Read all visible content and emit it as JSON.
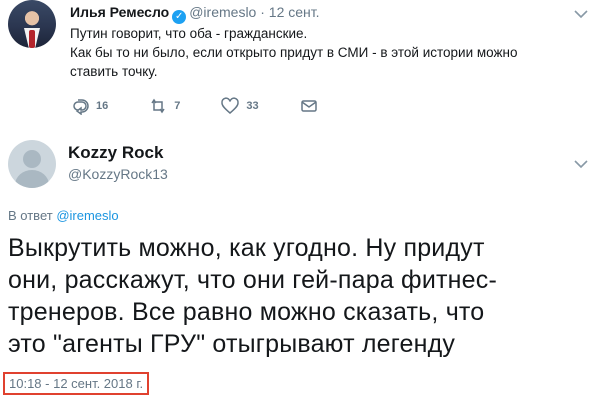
{
  "tweet1": {
    "name": "Илья Ремесло",
    "handle": "@iremeslo",
    "date": "· 12 сент.",
    "text_lines": [
      "Путин говорит, что оба - гражданские.",
      "Как бы то ни было, если открыто придут в СМИ - в этой истории можно",
      "ставить точку."
    ],
    "actions": {
      "reply_count": "16",
      "retweet_count": "7",
      "like_count": "33"
    }
  },
  "tweet2": {
    "name": "Kozzy Rock",
    "handle": "@KozzyRock13",
    "reply_prefix": "В ответ ",
    "reply_mention": "@iremeslo",
    "text_lines": [
      "Выкрутить можно, как угодно. Ну придут",
      "они, расскажут, что они гей-пара фитнес-",
      "тренеров. Все равно можно сказать, что",
      "это \"агенты ГРУ\" отыгрывают легенду"
    ],
    "timestamp": "10:18 - 12 сент. 2018 г."
  },
  "colors": {
    "accent": "#1da1f2",
    "muted": "#657786",
    "highlight_border": "#e0412f"
  }
}
